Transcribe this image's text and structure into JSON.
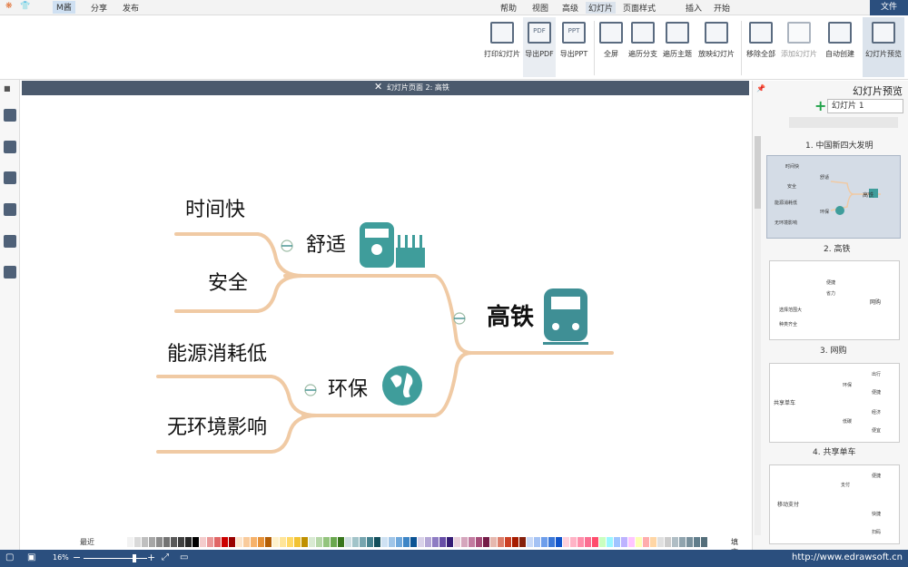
{
  "menubar": {
    "file": "文件",
    "start": "开始",
    "insert": "插入",
    "page_layout": "页面样式",
    "slides": "幻灯片",
    "advanced": "高级",
    "view": "视图",
    "help": "帮助",
    "publish": "发布",
    "share": "分享",
    "user": "M酱"
  },
  "ribbon": {
    "buttons": [
      "幻灯片预览",
      "自动创建",
      "添加幻灯片",
      "移除全部",
      "放映幻灯片",
      "遍历主题",
      "遍历分支",
      "全屏",
      "导出PPT",
      "导出PDF",
      "打印幻灯片"
    ],
    "ppt_tag": "PPT",
    "pdf_tag": "PDF"
  },
  "document": {
    "tab_title": "幻灯片页面 2: 高铁"
  },
  "mindmap": {
    "root": "高铁",
    "branch1": "舒适",
    "branch1_children": [
      "时间快",
      "安全"
    ],
    "branch2": "环保",
    "branch2_children": [
      "能源消耗低",
      "无环境影响"
    ]
  },
  "palette": {
    "label": "填充",
    "recent": "最近"
  },
  "status": {
    "url": "http://www.edrawsoft.cn",
    "zoom": "16%"
  },
  "right_panel": {
    "title": "幻灯片预览",
    "select_value": "幻灯片 1",
    "slides": [
      {
        "label": "1. 中国新四大发明"
      },
      {
        "label": "2. 高铁"
      },
      {
        "label": "3. 网购"
      },
      {
        "label": "4. 共享单车"
      }
    ],
    "thumb1": {
      "root": "高铁",
      "items": [
        "时间快",
        "舒适",
        "安全",
        "能源消耗低",
        "环保",
        "无环境影响"
      ]
    },
    "thumb2": {
      "root": "网购",
      "items": [
        "便捷",
        "省力",
        "选择范围大",
        "种类齐全"
      ]
    },
    "thumb3": {
      "root": "共享单车",
      "items": [
        "出行",
        "便捷",
        "环保",
        "低碳",
        "经济",
        "便宜"
      ]
    },
    "thumb4": {
      "root": "移动支付",
      "items": [
        "便捷",
        "支付",
        "快捷",
        "扫码"
      ]
    }
  },
  "colors": {
    "accent": "#2b4f7e",
    "branch": "#f0caa4",
    "icon_teal": "#3f9d9b"
  }
}
